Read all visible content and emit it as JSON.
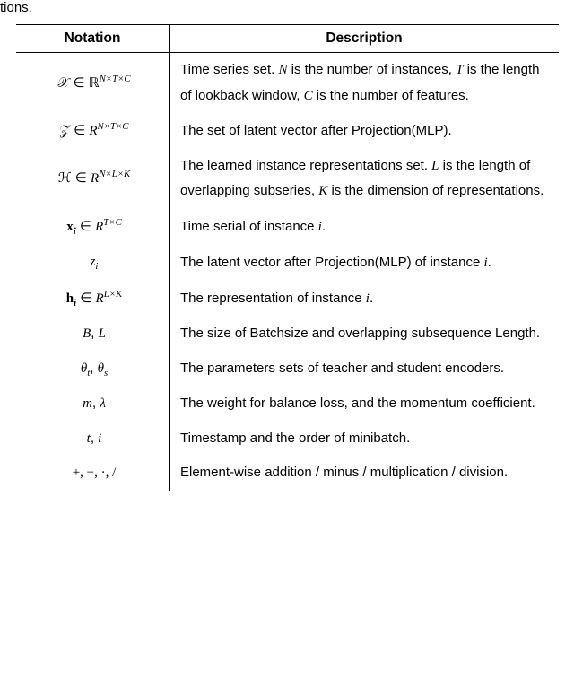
{
  "fragment": "tions.",
  "headers": {
    "notation": "Notation",
    "description": "Description"
  },
  "rows": [
    {
      "notation_html": "<span class='mc'>𝒳</span> <span class='mr'>∈</span> <span class='bb'>ℝ</span><span class='sup'>N×T×C</span>",
      "desc_html": "Time series set. <span class='mi'>N</span> is the number of instances, <span class='mi'>T</span> is the length of lookback window, <span class='mi'>C</span> is the number of features."
    },
    {
      "notation_html": "<span class='mc'>𝒵</span> <span class='mr'>∈</span> <span class='mi'>R</span><span class='sup'>N×T×C</span>",
      "desc_html": "The set of latent vector after Projection(MLP)."
    },
    {
      "notation_html": "<span class='mc'>ℋ</span> <span class='mr'>∈</span> <span class='mi'>R</span><span class='sup'>N×L×K</span>",
      "desc_html": "The learned instance representations set. <span class='mi'>L</span> is the length of overlapping subseries, <span class='mi'>K</span> is the dimension of representations."
    },
    {
      "notation_html": "<span class='mb'>x</span><span class='sub'><b>i</b></span> <span class='mr'>∈</span> <span class='mi'>R</span><span class='sup'>T×C</span>",
      "desc_html": "Time serial of instance <span class='mi'>i</span>."
    },
    {
      "notation_html": "<span class='mi'>z</span><span class='sub'>i</span>",
      "desc_html": "The latent vector after Projection(MLP) of instance <span class='mi'>i</span>."
    },
    {
      "notation_html": "<span class='mb'>h</span><span class='sub'><b>i</b></span> <span class='mr'>∈</span> <span class='mi'>R</span><span class='sup'>L×K</span>",
      "desc_html": "The representation of instance <span class='mi'>i</span>."
    },
    {
      "notation_html": "<span class='mi'>B</span>, <span class='mi'>L</span>",
      "desc_html": "The size of Batchsize and overlapping subsequence Length."
    },
    {
      "notation_html": "<span class='mi'>θ</span><span class='sub'>t</span>, <span class='mi'>θ</span><span class='sub'>s</span>",
      "desc_html": "The parameters sets of teacher and student encoders."
    },
    {
      "notation_html": "<span class='mi'>m</span>, <span class='mi'>λ</span>",
      "desc_html": "The weight for balance loss, and the momentum coefficient."
    },
    {
      "notation_html": "<span class='mi'>t</span>, <span class='mi'>i</span>",
      "desc_html": "Timestamp and the order of minibatch."
    },
    {
      "notation_html": "<span class='mr'>+, −, ·, /</span>",
      "desc_html": "Element-wise addition / minus / multiplication / division."
    }
  ],
  "chart_data": {
    "type": "table",
    "title": "Notation table",
    "columns": [
      "Notation",
      "Description"
    ],
    "rows": [
      [
        "X ∈ ℝ^{N×T×C}",
        "Time series set. N is the number of instances, T is the length of lookback window, C is the number of features."
      ],
      [
        "Z ∈ R^{N×T×C}",
        "The set of latent vector after Projection(MLP)."
      ],
      [
        "H ∈ R^{N×L×K}",
        "The learned instance representations set. L is the length of overlapping subseries, K is the dimension of representations."
      ],
      [
        "x_i ∈ R^{T×C}",
        "Time serial of instance i."
      ],
      [
        "z_i",
        "The latent vector after Projection(MLP) of instance i."
      ],
      [
        "h_i ∈ R^{L×K}",
        "The representation of instance i."
      ],
      [
        "B, L",
        "The size of Batchsize and overlapping subsequence Length."
      ],
      [
        "θ_t, θ_s",
        "The parameters sets of teacher and student encoders."
      ],
      [
        "m, λ",
        "The weight for balance loss, and the momentum coefficient."
      ],
      [
        "t, i",
        "Timestamp and the order of minibatch."
      ],
      [
        "+, −, ·, /",
        "Element-wise addition / minus / multiplication / division."
      ]
    ]
  }
}
